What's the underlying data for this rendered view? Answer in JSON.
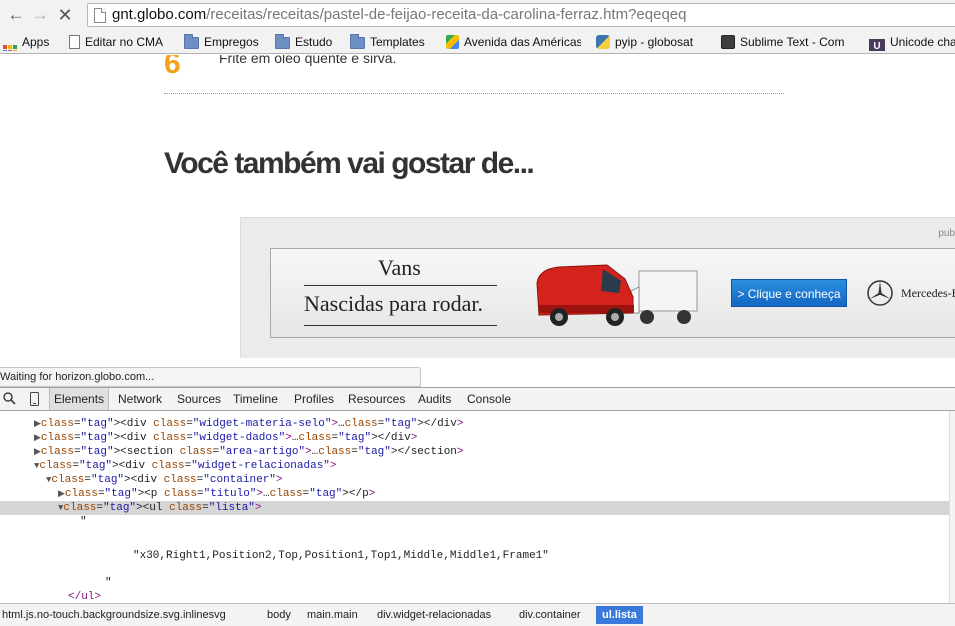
{
  "browser": {
    "url_host": "gnt.globo.com",
    "url_path": "/receitas/receitas/pastel-de-feijao-receita-da-carolina-ferraz.htm?eqeqeq",
    "bookmarks": [
      {
        "label": "Apps",
        "icon": "apps-icon"
      },
      {
        "label": "Editar no CMA",
        "icon": "page-icon"
      },
      {
        "label": "Empregos",
        "icon": "folder-icon"
      },
      {
        "label": "Estudo",
        "icon": "folder-icon"
      },
      {
        "label": "Templates",
        "icon": "folder-icon"
      },
      {
        "label": "Avenida das Américas",
        "icon": "maps-icon"
      },
      {
        "label": "pyip - globosat",
        "icon": "python-icon"
      },
      {
        "label": "Sublime Text - Com",
        "icon": "sublime-icon"
      },
      {
        "label": "Unicode cha",
        "icon": "unicode-icon"
      }
    ]
  },
  "page": {
    "step_number": "6",
    "step_text": "Frite em óleo quente e sirva.",
    "section_title": "Você também vai gostar de...",
    "ad": {
      "label": "pub",
      "headline_1": "Vans",
      "headline_2": "Nascidas para rodar.",
      "cta": "> Clique e conheça",
      "brand": "Mercedes-Benz"
    }
  },
  "status_text": "Waiting for horizon.globo.com...",
  "devtools": {
    "tabs": [
      "Elements",
      "Network",
      "Sources",
      "Timeline",
      "Profiles",
      "Resources",
      "Audits",
      "Console"
    ],
    "active_tab": "Elements",
    "rows": [
      {
        "indent": 4,
        "tri": "▶",
        "text": "<div class=\"widget-materia-selo\">…</div>"
      },
      {
        "indent": 4,
        "tri": "▶",
        "text": "<div class=\"widget-dados\">…</div>"
      },
      {
        "indent": 4,
        "tri": "▶",
        "text": "<section class=\"area-artigo\">…</section>"
      },
      {
        "indent": 4,
        "tri": "▼",
        "text": "<div class=\"widget-relacionadas\">"
      },
      {
        "indent": 6,
        "tri": "▼",
        "text": "<div class=\"container\">"
      },
      {
        "indent": 8,
        "tri": "▶",
        "text": "<p class=\"titulo\">…</p>"
      },
      {
        "indent": 8,
        "tri": "▼",
        "text": "<ul class=\"lista\">"
      }
    ],
    "text_quote_open": "\"",
    "text_value": "\"x30,Right1,Position2,Top,Position1,Top1,Middle,Middle1,Frame1\"",
    "text_quote_close": "\"",
    "closing_tag": "</ul>",
    "breadcrumbs": [
      "html.js.no-touch.backgroundsize.svg.inlinesvg",
      "body",
      "main.main",
      "div.widget-relacionadas",
      "div.container",
      "ul.lista"
    ]
  },
  "colors": {
    "accent_step": "#f2a21b",
    "tag": "#881280",
    "attr": "#994500",
    "value": "#1a1aa6",
    "crumb_active": "#3879d9"
  }
}
